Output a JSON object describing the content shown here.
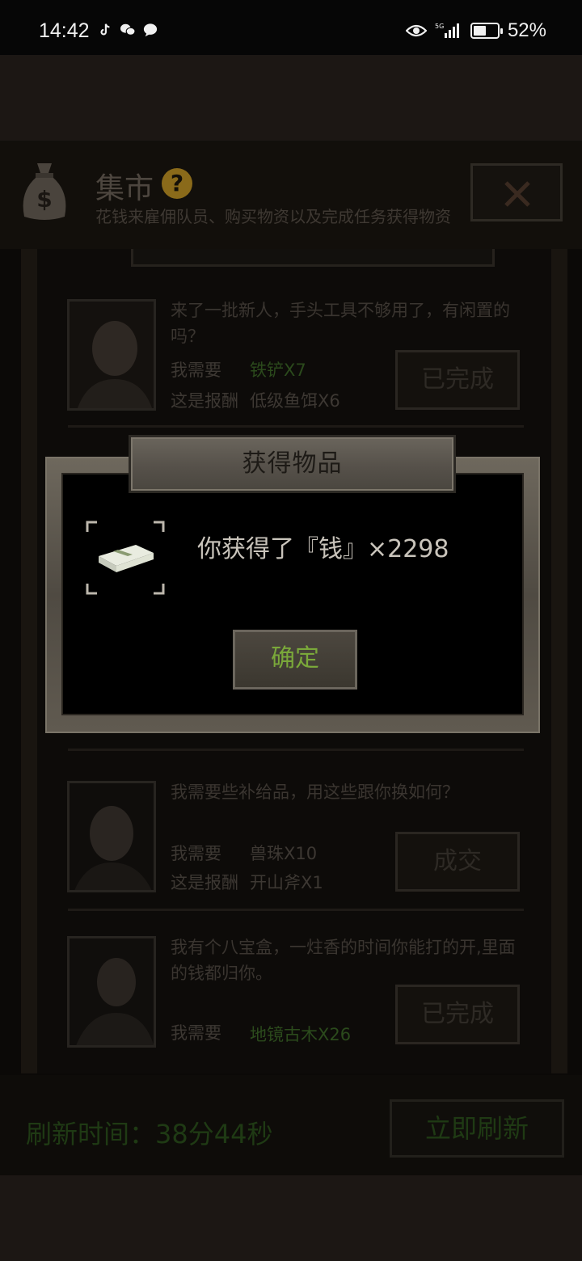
{
  "status_bar": {
    "time": "14:42",
    "network": "5G",
    "battery": "52%",
    "battery_level": 0.52
  },
  "header": {
    "title": "集市",
    "help_glyph": "?",
    "subtitle": "花钱来雇佣队员、购买物资以及完成任务获得物资",
    "close_glyph": "×"
  },
  "quests": [
    {
      "text": "来了一批新人，手头工具不够用了，有闲置的吗？",
      "need_label": "我需要",
      "need_value": "铁铲X7",
      "reward_label": "这是报酬",
      "reward_value": "低级鱼饵X6",
      "button": "已完成"
    },
    {
      "text": "我需要些补给品，用这些跟你换如何？",
      "need_label": "我需要",
      "need_value": "兽珠X10",
      "reward_label": "这是报酬",
      "reward_value": "开山斧X1",
      "button": "成交"
    },
    {
      "text": "我有个八宝盒，一炷香的时间你能打的开,里面的钱都归你。",
      "need_label": "我需要",
      "need_value": "地镜古木X26",
      "button": "已完成"
    }
  ],
  "footer": {
    "refresh_label": "刷新时间：38分44秒",
    "refresh_button": "立即刷新"
  },
  "modal": {
    "title": "获得物品",
    "message": "你获得了『钱』×2298",
    "confirm": "确定"
  },
  "colors": {
    "accent_green": "#7aa83a",
    "help_gold": "#8a6a1a"
  }
}
